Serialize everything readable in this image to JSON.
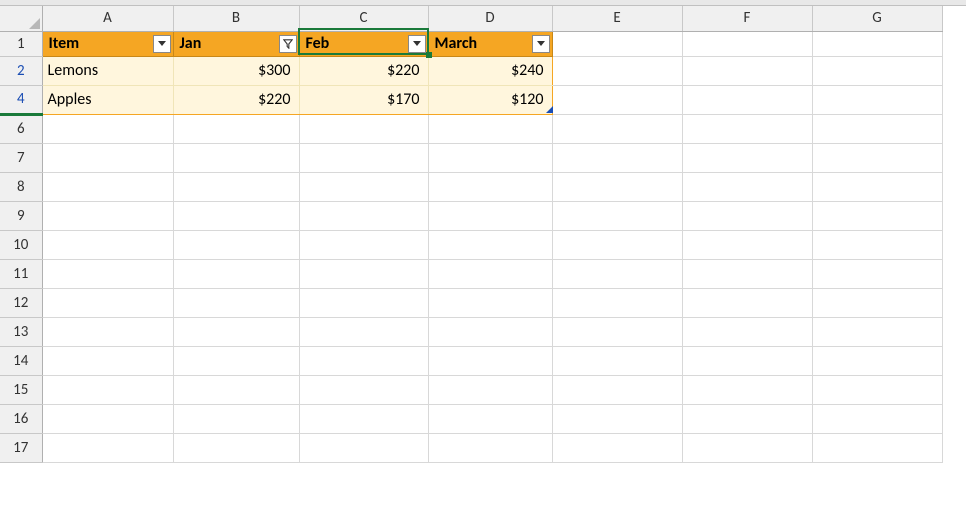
{
  "columns": [
    "A",
    "B",
    "C",
    "D",
    "E",
    "F",
    "G"
  ],
  "rowNumbers": [
    "1",
    "2",
    "4",
    "6",
    "7",
    "8",
    "9",
    "10",
    "11",
    "12",
    "13",
    "14",
    "15",
    "16",
    "17"
  ],
  "dataRowIndices": [
    1,
    2
  ],
  "filteredGapAfter": [
    2
  ],
  "tableHeaders": {
    "A": "Item",
    "B": "Jan",
    "C": "Feb",
    "D": "March"
  },
  "filterActive": {
    "A": false,
    "B": true,
    "C": false,
    "D": false
  },
  "tableRows": [
    {
      "A": "Lemons",
      "B": "$300",
      "C": "$220",
      "D": "$240"
    },
    {
      "A": "Apples",
      "B": "$220",
      "C": "$170",
      "D": "$120"
    }
  ],
  "activeCell": "C1",
  "chart_data": {
    "type": "table",
    "columns": [
      "Item",
      "Jan",
      "Feb",
      "March"
    ],
    "rows": [
      [
        "Lemons",
        300,
        220,
        240
      ],
      [
        "Apples",
        220,
        170,
        120
      ]
    ]
  }
}
